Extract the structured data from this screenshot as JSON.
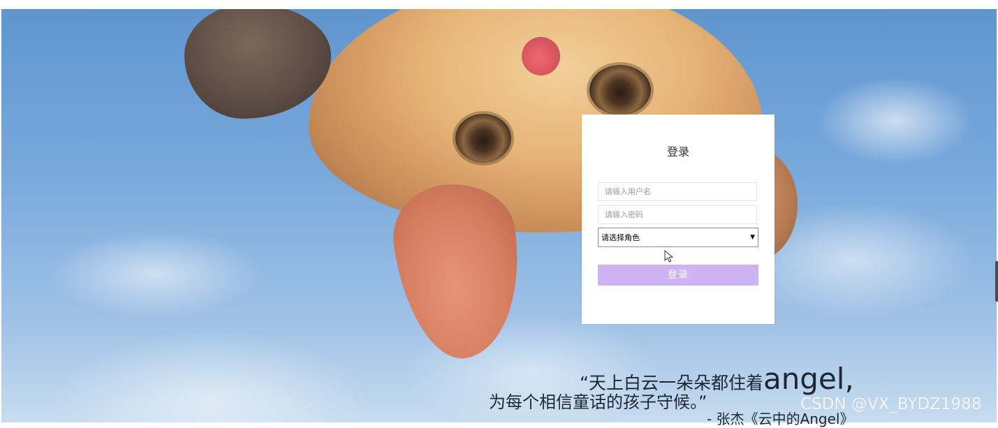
{
  "login": {
    "title": "登录",
    "username_placeholder": "请输入用户名",
    "password_placeholder": "请输入密码",
    "role_select_text": "请选择角色",
    "role_select_icon": "▼",
    "submit_label": "登录"
  },
  "quote": {
    "line1_prefix": "“天上白云一朵朵都住着",
    "line1_accent": "angel,",
    "line2": "为每个相信童话的孩子守候。”",
    "line3": "- 张杰《云中的Angel》"
  },
  "watermark": "CSDN @VX_BYDZ1988",
  "colors": {
    "login_button": "#cdb3f1",
    "card_background": "#ffffff",
    "sky_top": "#5f95cf",
    "sky_bottom": "#c7dcef"
  },
  "icons": {
    "select_chevron": "chevron-down-icon",
    "cursor": "mouse-pointer-icon"
  }
}
